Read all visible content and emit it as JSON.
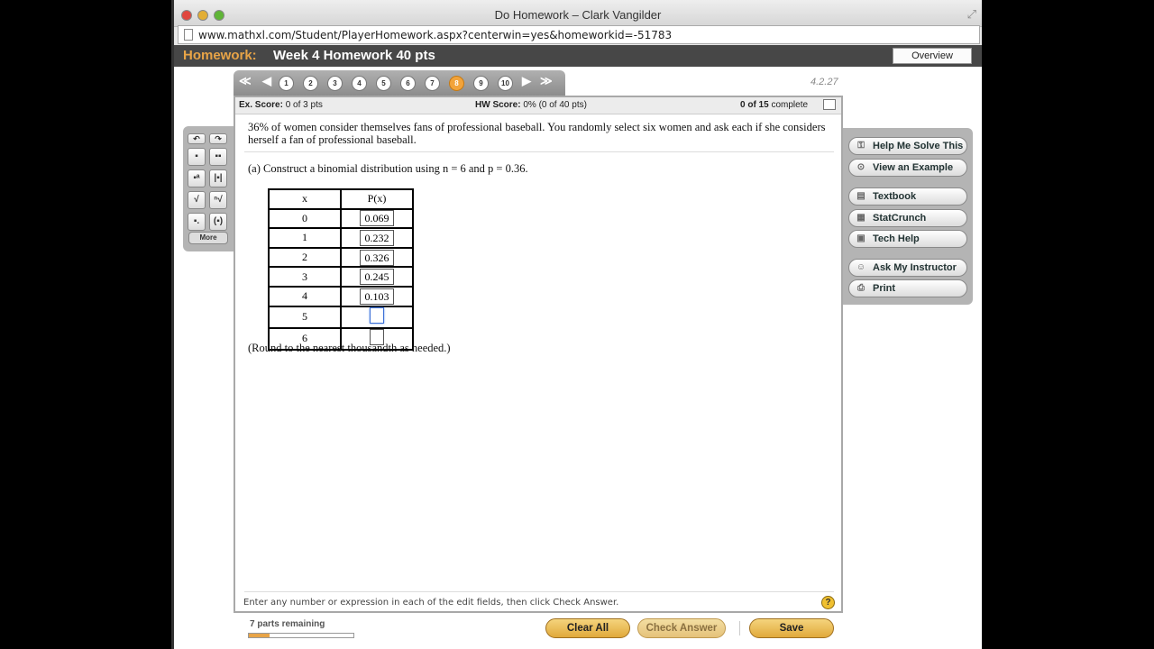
{
  "window": {
    "title": "Do Homework – Clark Vangilder",
    "url": "www.mathxl.com/Student/PlayerHomework.aspx?centerwin=yes&homeworkid=-51783"
  },
  "header": {
    "label": "Homework:",
    "title": "Week 4 Homework 40 pts",
    "overview_label": "Overview"
  },
  "nav": {
    "questions": [
      "1",
      "2",
      "3",
      "4",
      "5",
      "6",
      "7",
      "8",
      "9",
      "10"
    ],
    "current": "8",
    "first_symbol": "≪",
    "prev_symbol": "◀",
    "next_symbol": "▶",
    "last_symbol": "≫"
  },
  "version": "4.2.27",
  "scores": {
    "ex_label": "Ex. Score:",
    "ex_value": "0 of 3 pts",
    "hw_label": "HW Score:",
    "hw_value": "0% (0 of 40 pts)",
    "complete_bold": "0 of 15",
    "complete_rest": "complete"
  },
  "question": {
    "text": "36% of women consider themselves fans of professional baseball. You randomly select six women and ask each if she considers herself a fan of professional baseball.",
    "part_a": "(a) Construct a binomial distribution using n = 6 and p = 0.36.",
    "table_header_x": "x",
    "table_header_p": "P(x)",
    "rows": [
      {
        "x": "0",
        "p": "0.069"
      },
      {
        "x": "1",
        "p": "0.232"
      },
      {
        "x": "2",
        "p": "0.326"
      },
      {
        "x": "3",
        "p": "0.245"
      },
      {
        "x": "4",
        "p": "0.103"
      },
      {
        "x": "5",
        "p": ""
      },
      {
        "x": "6",
        "p": ""
      }
    ],
    "round_note": "(Round to the nearest thousandth as needed.)",
    "instructions": "Enter any number or expression in each of the edit fields, then click Check Answer."
  },
  "sidebar": {
    "items": [
      {
        "label": "Help Me Solve This",
        "icon": "key-icon"
      },
      {
        "label": "View an Example",
        "icon": "binoculars-icon"
      },
      {
        "label": "Textbook",
        "icon": "book-icon"
      },
      {
        "label": "StatCrunch",
        "icon": "statcrunch-icon"
      },
      {
        "label": "Tech Help",
        "icon": "calculator-icon"
      },
      {
        "label": "Ask My Instructor",
        "icon": "person-icon"
      },
      {
        "label": "Print",
        "icon": "printer-icon"
      }
    ]
  },
  "toolbox": {
    "more_label": "More"
  },
  "bottom": {
    "parts_remaining": "7 parts remaining",
    "progress": 0.2,
    "clear_all": "Clear All",
    "check_answer": "Check Answer",
    "save": "Save"
  }
}
